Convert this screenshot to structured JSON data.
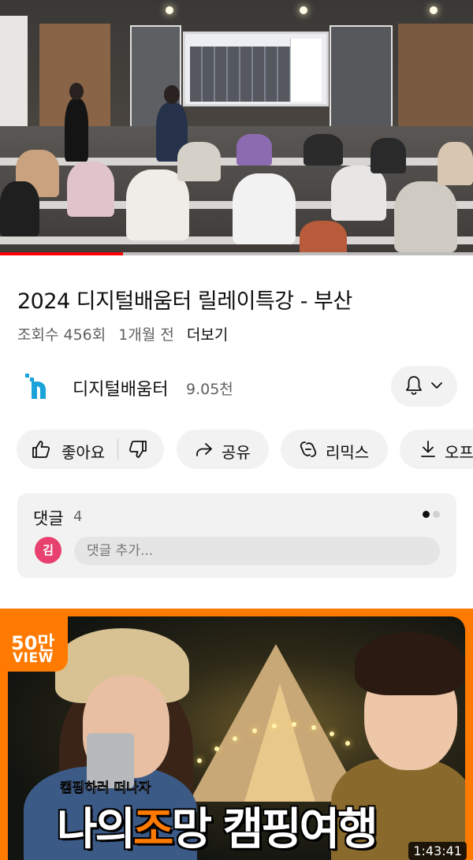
{
  "player": {
    "progress_fraction": 0.26
  },
  "video": {
    "title": "2024 디지털배움터 릴레이특강 - 부산",
    "views": "조회수 456회",
    "age": "1개월 전",
    "more_label": "더보기"
  },
  "channel": {
    "name": "디지털배움터",
    "subscribers": "9.05천",
    "logo_color": "#1aa3d9"
  },
  "actions": {
    "like_label": "좋아요",
    "share_label": "공유",
    "remix_label": "리믹스",
    "download_label": "오프라인 저장"
  },
  "comments": {
    "title": "댓글",
    "count": "4",
    "avatar_letter": "김",
    "avatar_color": "#e8416f",
    "placeholder": "댓글 추가..."
  },
  "next_video": {
    "badge_number": "50만",
    "badge_label": "VIEW",
    "subtitle": "캠핑하러 떠나자",
    "title_part1": "나의",
    "title_accent": "조",
    "title_part2": "망 캠핑여행",
    "duration": "1:43:41",
    "accent_color": "#ff7a00"
  }
}
